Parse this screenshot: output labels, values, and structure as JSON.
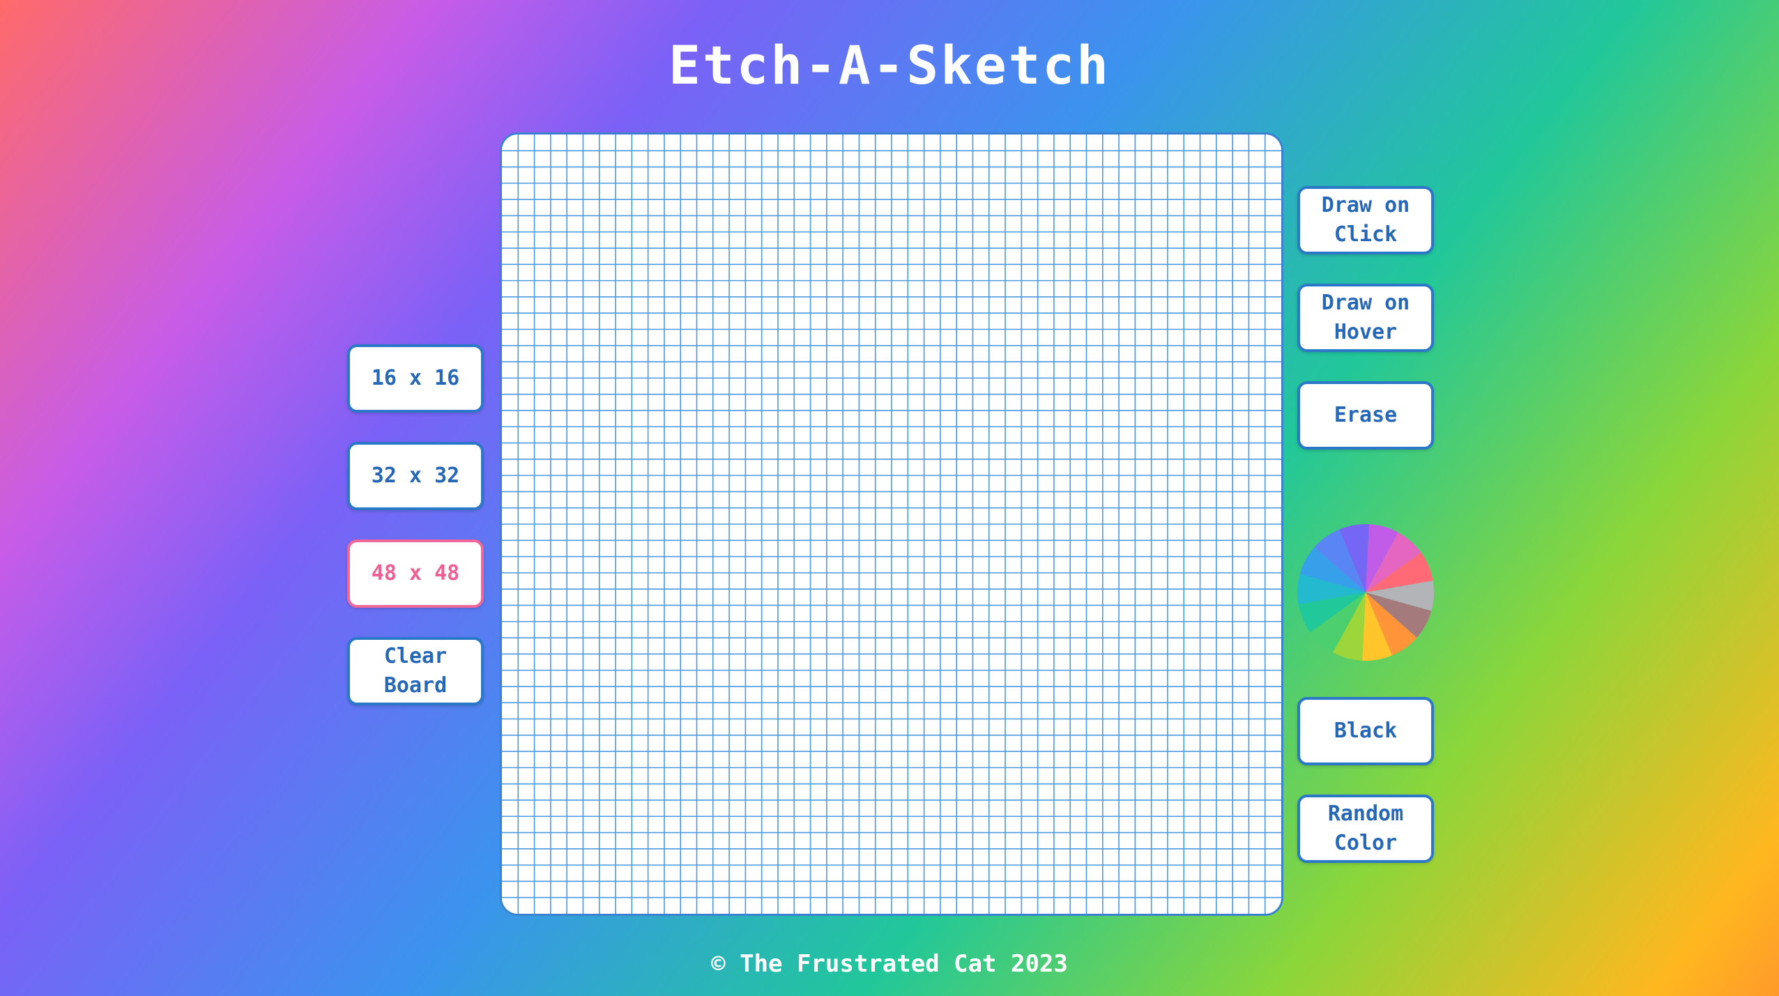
{
  "app": {
    "title": "Etch-A-Sketch"
  },
  "board": {
    "grid_size": 48,
    "cell_color": "#ffffff",
    "line_color": "#4a9ae0",
    "border_color": "#3a82d1"
  },
  "left_controls": {
    "size_16_label": "16 x 16",
    "size_32_label": "32 x 32",
    "size_48_label": "48 x 48",
    "clear_label": "Clear\nBoard",
    "active_size": "48 x 48"
  },
  "right_controls": {
    "draw_click_label": "Draw on\nClick",
    "draw_hover_label": "Draw on\nHover",
    "erase_label": "Erase",
    "black_label": "Black",
    "random_label": "Random\nColor"
  },
  "color_wheel": {
    "icon": "color-wheel-icon",
    "segments": [
      "#c15ce8",
      "#e466c0",
      "#ff6a76",
      "#b2b4b8",
      "#a57a7c",
      "#ff9538",
      "#ffc52a",
      "#9dd63a",
      "#4ccf6e",
      "#21c89a",
      "#23b9cf",
      "#37a0ea",
      "#5a86f5",
      "#7566f6"
    ]
  },
  "footer": {
    "text": "© The Frustrated Cat 2023"
  },
  "colors": {
    "button_text": "#2667b6",
    "button_border": "#2b78c9",
    "active_accent": "#f0679a"
  }
}
